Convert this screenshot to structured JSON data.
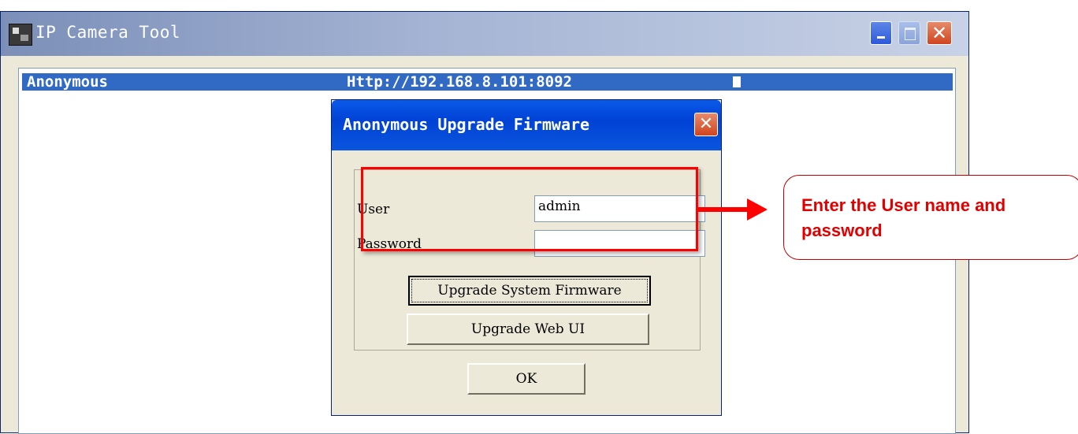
{
  "main_window": {
    "title": "IP Camera Tool",
    "app_icon": "camera-tool-app-icon",
    "controls": {
      "minimize_icon": "minimize-icon",
      "maximize_icon": "maximize-icon",
      "close_icon": "close-icon",
      "close_glyph": "✕"
    }
  },
  "device_list": {
    "rows": [
      {
        "name": "Anonymous",
        "url": "Http://192.168.8.101:8092",
        "selected": true
      }
    ]
  },
  "dialog": {
    "title": "Anonymous Upgrade Firmware",
    "close_glyph": "✕",
    "user_label": "User",
    "user_value": "admin",
    "password_label": "Password",
    "password_value": "",
    "upgrade_system_button": "Upgrade System Firmware",
    "upgrade_web_button": "Upgrade Web UI",
    "ok_button": "OK"
  },
  "annotation": {
    "callout_text": "Enter the User name and password",
    "highlight_color": "#FF0000",
    "callout_text_color": "#E00000"
  },
  "colors": {
    "selection": "#316AC5",
    "dialog_title_bar": "#0042D5",
    "window_face": "#ECE9D8"
  }
}
